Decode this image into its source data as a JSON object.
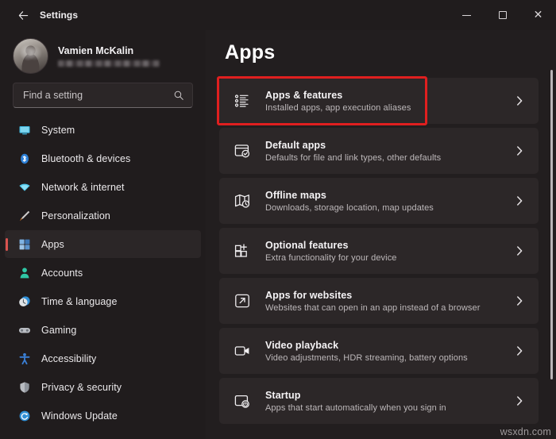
{
  "window": {
    "app_title": "Settings",
    "back_icon": "back-arrow-icon",
    "controls": {
      "minimize": "minimize-icon",
      "maximize": "maximize-icon",
      "close": "close-icon"
    }
  },
  "sidebar": {
    "profile": {
      "name": "Vamien McKalin",
      "email_redacted": true,
      "avatar": "user-avatar"
    },
    "search": {
      "placeholder": "Find a setting",
      "icon": "search-icon",
      "value": ""
    },
    "items": [
      {
        "label": "System",
        "icon": "monitor-icon",
        "color": "#3fb7e0",
        "active": false
      },
      {
        "label": "Bluetooth & devices",
        "icon": "bluetooth-icon",
        "color": "#2c7fd6",
        "active": false
      },
      {
        "label": "Network & internet",
        "icon": "wifi-icon",
        "color": "#4ec7ea",
        "active": false
      },
      {
        "label": "Personalization",
        "icon": "paintbrush-icon",
        "color": "#e08a3c",
        "active": false
      },
      {
        "label": "Apps",
        "icon": "apps-grid-icon",
        "color": "#5b9bd5",
        "active": true
      },
      {
        "label": "Accounts",
        "icon": "person-icon",
        "color": "#2fc7a5",
        "active": false
      },
      {
        "label": "Time & language",
        "icon": "clock-icon",
        "color": "#2f8fd6",
        "active": false
      },
      {
        "label": "Gaming",
        "icon": "gamepad-icon",
        "color": "#b9bcc2",
        "active": false
      },
      {
        "label": "Accessibility",
        "icon": "accessibility-icon",
        "color": "#3a7fd5",
        "active": false
      },
      {
        "label": "Privacy & security",
        "icon": "shield-icon",
        "color": "#b9bcc2",
        "active": false
      },
      {
        "label": "Windows Update",
        "icon": "refresh-icon",
        "color": "#2f8fd6",
        "active": false
      }
    ],
    "accent_color": "#d9534f"
  },
  "main": {
    "page_title": "Apps",
    "highlight_color": "#e01f1f",
    "cards": [
      {
        "title": "Apps & features",
        "subtitle": "Installed apps, app execution aliases",
        "icon": "list-bullets-icon",
        "chevron": "chevron-right-icon",
        "highlighted": true
      },
      {
        "title": "Default apps",
        "subtitle": "Defaults for file and link types, other defaults",
        "icon": "window-check-icon",
        "chevron": "chevron-right-icon",
        "highlighted": false
      },
      {
        "title": "Offline maps",
        "subtitle": "Downloads, storage location, map updates",
        "icon": "map-clock-icon",
        "chevron": "chevron-right-icon",
        "highlighted": false
      },
      {
        "title": "Optional features",
        "subtitle": "Extra functionality for your device",
        "icon": "grid-plus-icon",
        "chevron": "chevron-right-icon",
        "highlighted": false
      },
      {
        "title": "Apps for websites",
        "subtitle": "Websites that can open in an app instead of a browser",
        "icon": "external-link-icon",
        "chevron": "chevron-right-icon",
        "highlighted": false
      },
      {
        "title": "Video playback",
        "subtitle": "Video adjustments, HDR streaming, battery options",
        "icon": "video-camera-icon",
        "chevron": "chevron-right-icon",
        "highlighted": false
      },
      {
        "title": "Startup",
        "subtitle": "Apps that start automatically when you sign in",
        "icon": "window-power-icon",
        "chevron": "chevron-right-icon",
        "highlighted": false
      }
    ]
  },
  "watermark": "wsxdn.com"
}
